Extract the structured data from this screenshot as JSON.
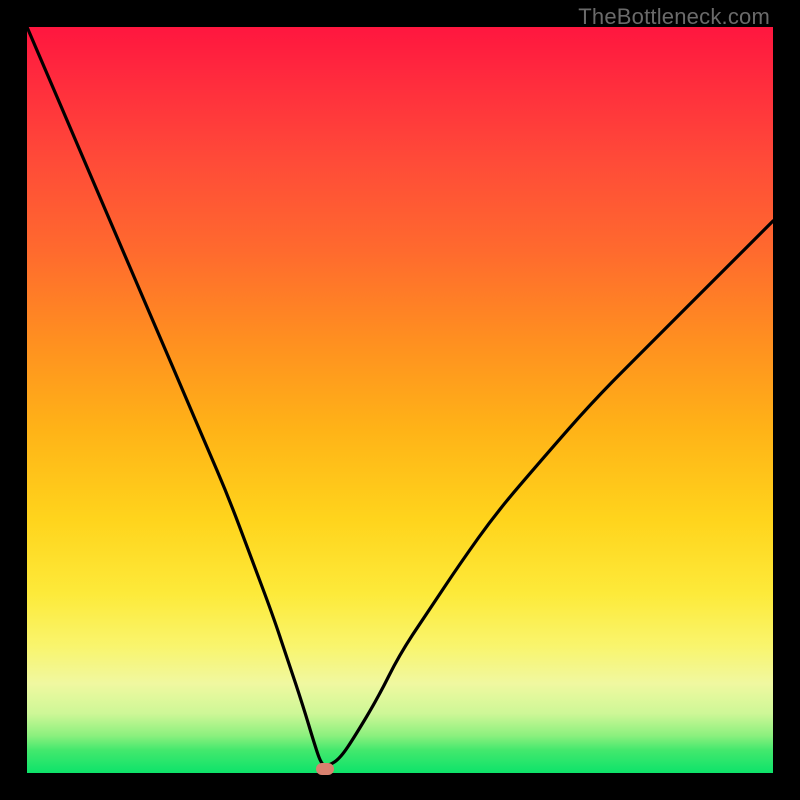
{
  "watermark": "TheBottleneck.com",
  "colors": {
    "frame": "#000000",
    "curve_stroke": "#000000",
    "marker": "#d9816f",
    "watermark_text": "#6a6a6a"
  },
  "chart_data": {
    "type": "line",
    "title": "",
    "xlabel": "",
    "ylabel": "",
    "xlim": [
      0,
      100
    ],
    "ylim": [
      0,
      100
    ],
    "note": "x = relative position across plot width (0–100). y = bottleneck % (0 = none, 100 = max). Curve is a V with minimum near x≈40.",
    "series": [
      {
        "name": "bottleneck-curve",
        "x": [
          0,
          3,
          6,
          9,
          12,
          15,
          18,
          21,
          24,
          27,
          30,
          33,
          35,
          37,
          38.5,
          39.5,
          40.5,
          42,
          44,
          47,
          50,
          54,
          58,
          63,
          69,
          76,
          84,
          93,
          100
        ],
        "y": [
          100,
          93,
          86,
          79,
          72,
          65,
          58,
          51,
          44,
          37,
          29,
          21,
          15,
          9,
          4,
          1,
          1,
          2,
          5,
          10,
          16,
          22,
          28,
          35,
          42,
          50,
          58,
          67,
          74
        ]
      }
    ],
    "marker": {
      "x": 40,
      "y": 0.5
    },
    "gradient_stops": [
      {
        "pos": 0,
        "color": "#ff163f"
      },
      {
        "pos": 50,
        "color": "#ffb317"
      },
      {
        "pos": 80,
        "color": "#fdea3a"
      },
      {
        "pos": 100,
        "color": "#0de36a"
      }
    ]
  }
}
